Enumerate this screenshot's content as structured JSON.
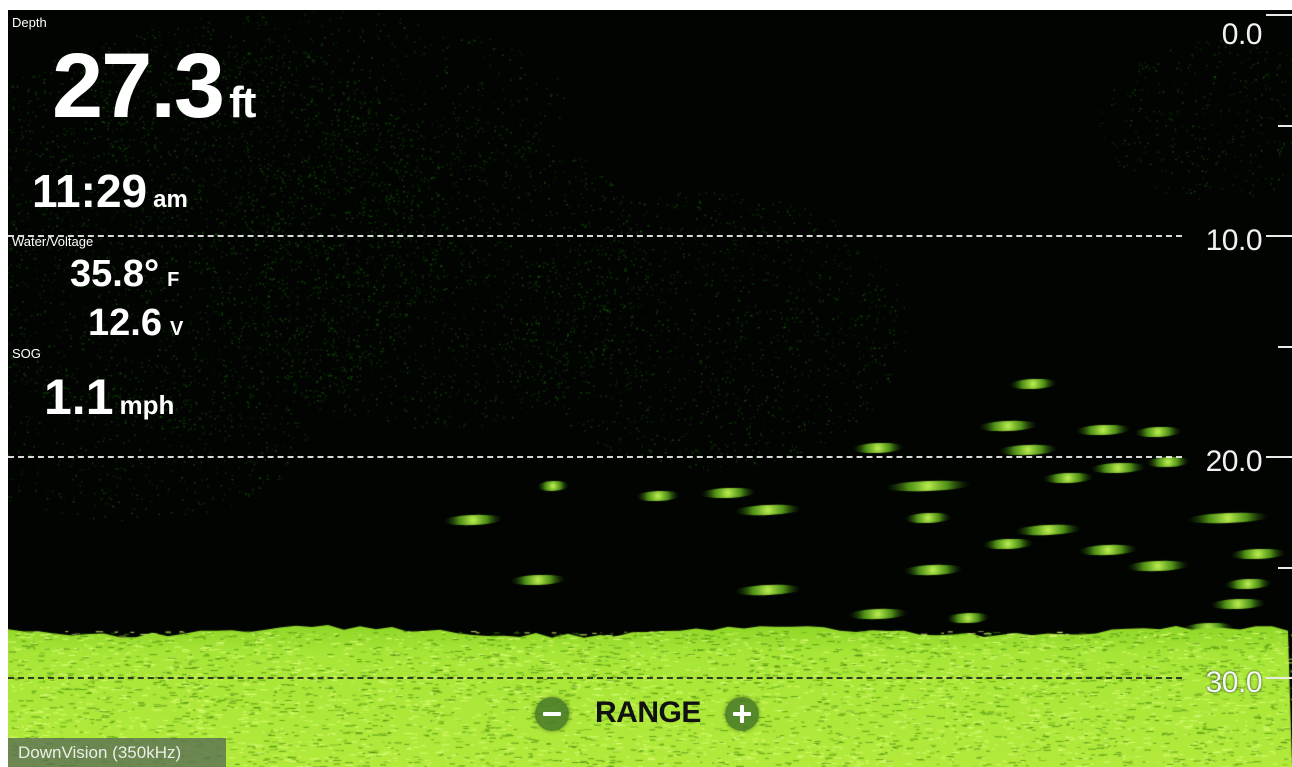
{
  "depth": {
    "title": "Depth",
    "value": "27.3",
    "unit": "ft"
  },
  "time": {
    "value": "11:29",
    "suffix": "am"
  },
  "water_voltage": {
    "title": "Water/Voltage",
    "temperature": "35.8°",
    "temperature_unit": "F",
    "voltage": "12.6",
    "voltage_unit": "V"
  },
  "sog": {
    "title": "SOG",
    "value": "1.1",
    "unit": "mph"
  },
  "depth_scale": {
    "labels": [
      "0.0",
      "10.0",
      "20.0",
      "30.0"
    ]
  },
  "range_control": {
    "label": "RANGE"
  },
  "mode_tab": {
    "label": "DownVision (350kHz)"
  },
  "colors": {
    "water_background": "#020402",
    "sonar_green": "#7fd92a",
    "bottom_green": "#a7e637",
    "overlay_text": "#ffffff"
  }
}
